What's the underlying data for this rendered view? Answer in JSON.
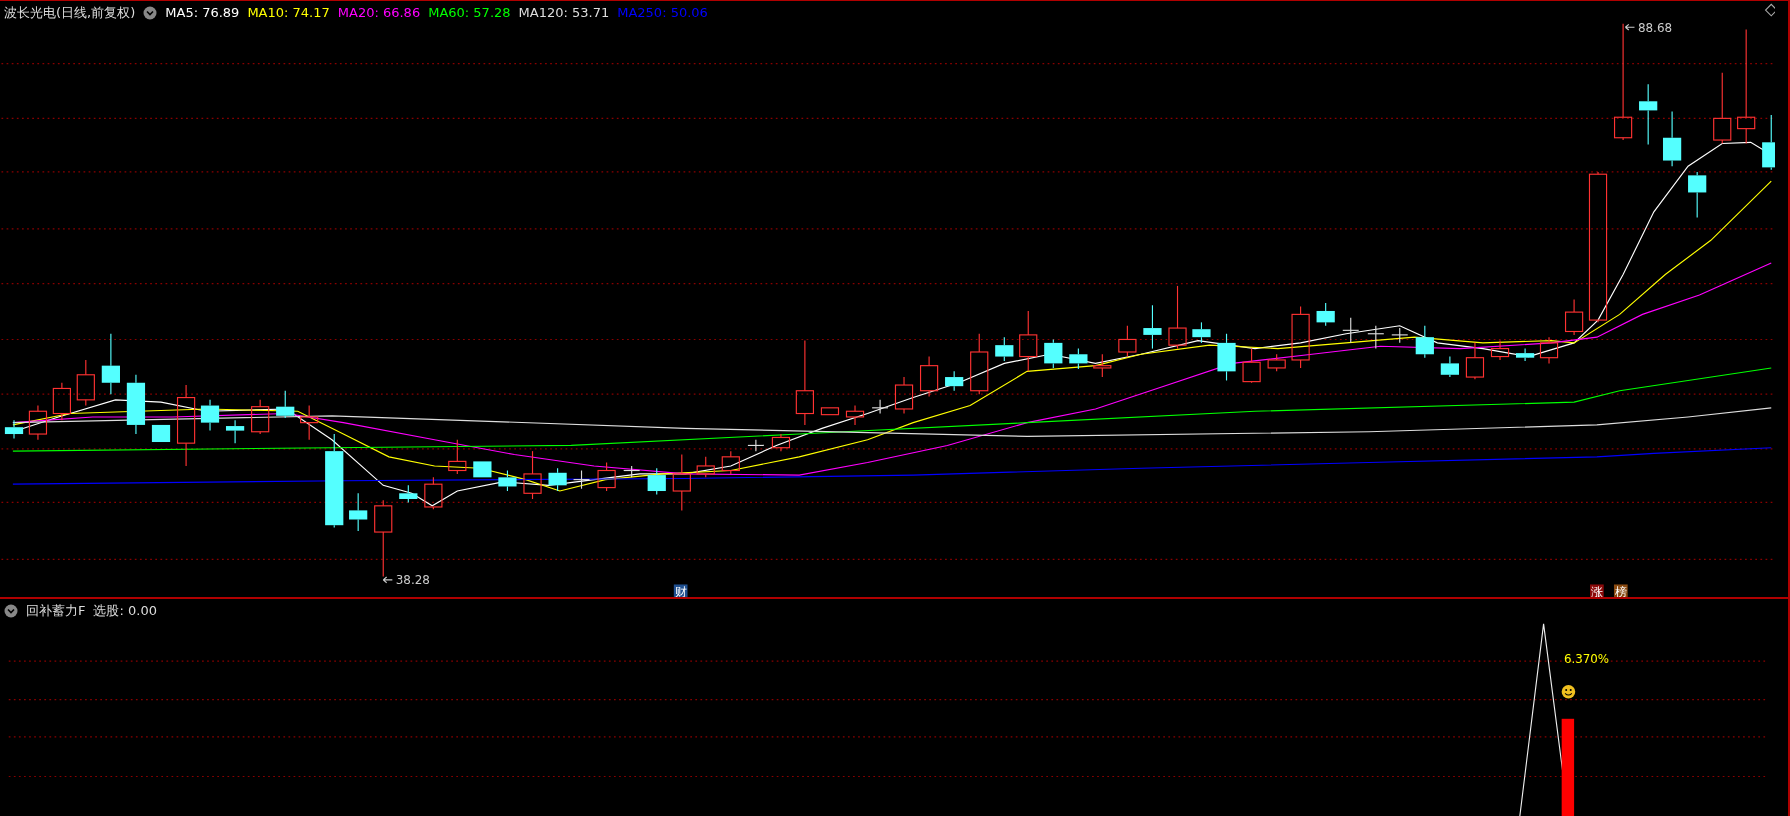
{
  "main_panel": {
    "title": "波长光电(日线,前复权)",
    "moving_averages": [
      {
        "label": "MA5: 76.89",
        "color": "#ffffff"
      },
      {
        "label": "MA10: 74.17",
        "color": "#ffff00"
      },
      {
        "label": "MA20: 66.86",
        "color": "#ff00ff"
      },
      {
        "label": "MA60: 57.28",
        "color": "#00ff00"
      },
      {
        "label": "MA120: 53.71",
        "color": "#dddddd"
      },
      {
        "label": "MA250: 50.06",
        "color": "#0000ff"
      }
    ],
    "high_label": "88.68",
    "low_label": "38.28",
    "markers": [
      {
        "text": "财",
        "color": "#1f4f8f"
      },
      {
        "text": "涨",
        "color": "#8b0a0a"
      },
      {
        "text": "榜",
        "color": "#8a4a10"
      }
    ]
  },
  "indicator_panel": {
    "title": "回补蓄力F",
    "reading": "选股: 0.00",
    "percent": "6.370%"
  }
}
